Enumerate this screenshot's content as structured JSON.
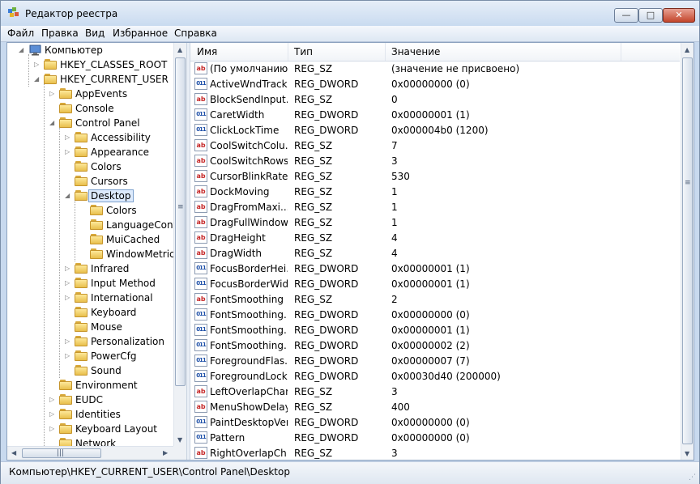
{
  "window": {
    "title": "Редактор реестра",
    "buttons": {
      "minimize": "—",
      "maximize": "□",
      "close": "✕"
    }
  },
  "menu": [
    "Файл",
    "Правка",
    "Вид",
    "Избранное",
    "Справка"
  ],
  "tree": {
    "root": "Компьютер",
    "items": [
      "HKEY_CLASSES_ROOT",
      "HKEY_CURRENT_USER",
      "AppEvents",
      "Console",
      "Control Panel",
      "Accessibility",
      "Appearance",
      "Colors",
      "Cursors",
      "Desktop",
      "Colors",
      "LanguageConf",
      "MuiCached",
      "WindowMetric",
      "Infrared",
      "Input Method",
      "International",
      "Keyboard",
      "Mouse",
      "Personalization",
      "PowerCfg",
      "Sound",
      "Environment",
      "EUDC",
      "Identities",
      "Keyboard Layout",
      "Network"
    ],
    "selected": "Desktop"
  },
  "list": {
    "headers": {
      "name": "Имя",
      "type": "Тип",
      "value": "Значение"
    },
    "rows": [
      {
        "name": "(По умолчанию)",
        "type": "REG_SZ",
        "value": "(значение не присвоено)",
        "icon": "string-value-icon"
      },
      {
        "name": "ActiveWndTrack...",
        "type": "REG_DWORD",
        "value": "0x00000000 (0)",
        "icon": "dword-value-icon"
      },
      {
        "name": "BlockSendInput...",
        "type": "REG_SZ",
        "value": "0",
        "icon": "string-value-icon"
      },
      {
        "name": "CaretWidth",
        "type": "REG_DWORD",
        "value": "0x00000001 (1)",
        "icon": "dword-value-icon"
      },
      {
        "name": "ClickLockTime",
        "type": "REG_DWORD",
        "value": "0x000004b0 (1200)",
        "icon": "dword-value-icon"
      },
      {
        "name": "CoolSwitchColu...",
        "type": "REG_SZ",
        "value": "7",
        "icon": "string-value-icon"
      },
      {
        "name": "CoolSwitchRows",
        "type": "REG_SZ",
        "value": "3",
        "icon": "string-value-icon"
      },
      {
        "name": "CursorBlinkRate",
        "type": "REG_SZ",
        "value": "530",
        "icon": "string-value-icon"
      },
      {
        "name": "DockMoving",
        "type": "REG_SZ",
        "value": "1",
        "icon": "string-value-icon"
      },
      {
        "name": "DragFromMaxi...",
        "type": "REG_SZ",
        "value": "1",
        "icon": "string-value-icon"
      },
      {
        "name": "DragFullWindows",
        "type": "REG_SZ",
        "value": "1",
        "icon": "string-value-icon"
      },
      {
        "name": "DragHeight",
        "type": "REG_SZ",
        "value": "4",
        "icon": "string-value-icon"
      },
      {
        "name": "DragWidth",
        "type": "REG_SZ",
        "value": "4",
        "icon": "string-value-icon"
      },
      {
        "name": "FocusBorderHei...",
        "type": "REG_DWORD",
        "value": "0x00000001 (1)",
        "icon": "dword-value-icon"
      },
      {
        "name": "FocusBorderWid...",
        "type": "REG_DWORD",
        "value": "0x00000001 (1)",
        "icon": "dword-value-icon"
      },
      {
        "name": "FontSmoothing",
        "type": "REG_SZ",
        "value": "2",
        "icon": "string-value-icon"
      },
      {
        "name": "FontSmoothing...",
        "type": "REG_DWORD",
        "value": "0x00000000 (0)",
        "icon": "dword-value-icon"
      },
      {
        "name": "FontSmoothing...",
        "type": "REG_DWORD",
        "value": "0x00000001 (1)",
        "icon": "dword-value-icon"
      },
      {
        "name": "FontSmoothing...",
        "type": "REG_DWORD",
        "value": "0x00000002 (2)",
        "icon": "dword-value-icon"
      },
      {
        "name": "ForegroundFlas...",
        "type": "REG_DWORD",
        "value": "0x00000007 (7)",
        "icon": "dword-value-icon"
      },
      {
        "name": "ForegroundLock...",
        "type": "REG_DWORD",
        "value": "0x00030d40 (200000)",
        "icon": "dword-value-icon"
      },
      {
        "name": "LeftOverlapChars",
        "type": "REG_SZ",
        "value": "3",
        "icon": "string-value-icon"
      },
      {
        "name": "MenuShowDelay",
        "type": "REG_SZ",
        "value": "400",
        "icon": "string-value-icon"
      },
      {
        "name": "PaintDesktopVer...",
        "type": "REG_DWORD",
        "value": "0x00000000 (0)",
        "icon": "dword-value-icon"
      },
      {
        "name": "Pattern",
        "type": "REG_DWORD",
        "value": "0x00000000 (0)",
        "icon": "dword-value-icon"
      },
      {
        "name": "RightOverlapCh...",
        "type": "REG_SZ",
        "value": "3",
        "icon": "string-value-icon"
      }
    ]
  },
  "status": {
    "path": "Компьютер\\HKEY_CURRENT_USER\\Control Panel\\Desktop"
  }
}
